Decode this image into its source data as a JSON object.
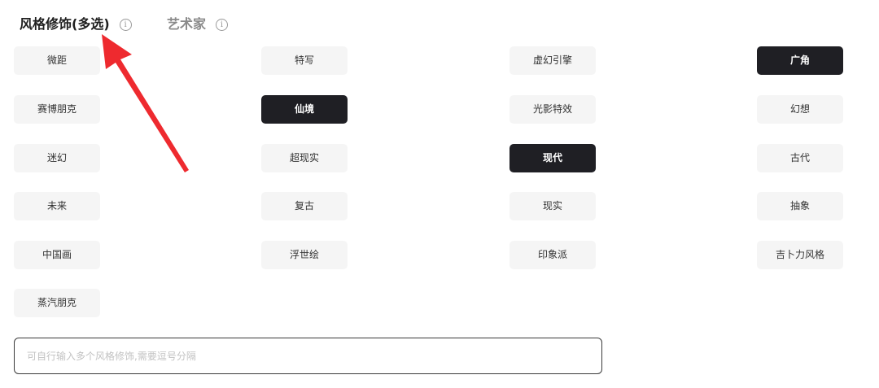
{
  "tabs": [
    {
      "label": "风格修饰(多选)",
      "active": true
    },
    {
      "label": "艺术家",
      "active": false
    }
  ],
  "info_icon_glyph": "i",
  "style_options": [
    {
      "label": "微距",
      "selected": false
    },
    {
      "label": "特写",
      "selected": false
    },
    {
      "label": "虚幻引擎",
      "selected": false
    },
    {
      "label": "广角",
      "selected": true
    },
    {
      "label": "赛博朋克",
      "selected": false
    },
    {
      "label": "仙境",
      "selected": true
    },
    {
      "label": "光影特效",
      "selected": false
    },
    {
      "label": "幻想",
      "selected": false
    },
    {
      "label": "迷幻",
      "selected": false
    },
    {
      "label": "超现实",
      "selected": false
    },
    {
      "label": "现代",
      "selected": true
    },
    {
      "label": "古代",
      "selected": false
    },
    {
      "label": "未来",
      "selected": false
    },
    {
      "label": "复古",
      "selected": false
    },
    {
      "label": "现实",
      "selected": false
    },
    {
      "label": "抽象",
      "selected": false
    },
    {
      "label": "中国画",
      "selected": false
    },
    {
      "label": "浮世绘",
      "selected": false
    },
    {
      "label": "印象派",
      "selected": false
    },
    {
      "label": "吉卜力风格",
      "selected": false
    },
    {
      "label": "蒸汽朋克",
      "selected": false
    }
  ],
  "custom_style_input": {
    "value": "",
    "placeholder": "可自行输入多个风格修饰,需要逗号分隔"
  },
  "annotation": {
    "icon": "red-arrow-icon",
    "color": "#ee2a2f"
  }
}
